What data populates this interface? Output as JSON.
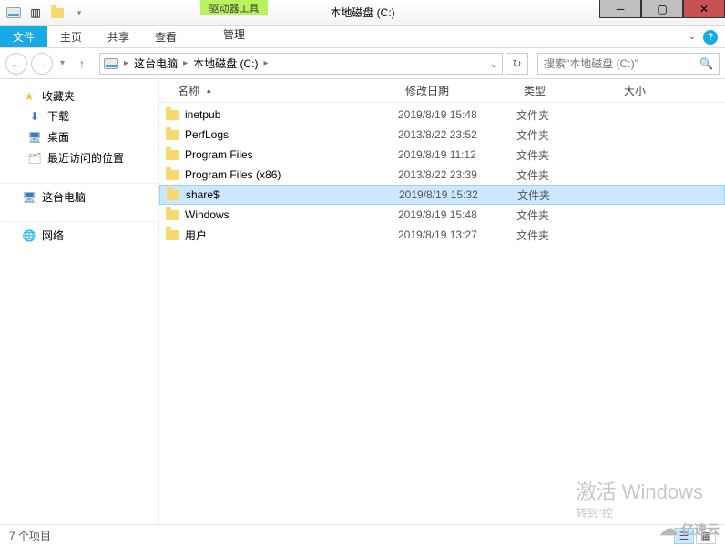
{
  "window": {
    "tool_tab": "驱动器工具",
    "title": "本地磁盘 (C:)"
  },
  "ribbon": {
    "file": "文件",
    "tabs": [
      "主页",
      "共享",
      "查看"
    ],
    "manage": "管理"
  },
  "address": {
    "crumbs": [
      "这台电脑",
      "本地磁盘 (C:)"
    ]
  },
  "search": {
    "placeholder": "搜索\"本地磁盘 (C:)\""
  },
  "sidebar": {
    "favorites": {
      "label": "收藏夹",
      "items": [
        "下载",
        "桌面",
        "最近访问的位置"
      ]
    },
    "this_pc": "这台电脑",
    "network": "网络"
  },
  "columns": {
    "name": "名称",
    "date": "修改日期",
    "type": "类型",
    "size": "大小"
  },
  "files": [
    {
      "name": "inetpub",
      "date": "2019/8/19 15:48",
      "type": "文件夹",
      "selected": false
    },
    {
      "name": "PerfLogs",
      "date": "2013/8/22 23:52",
      "type": "文件夹",
      "selected": false
    },
    {
      "name": "Program Files",
      "date": "2019/8/19 11:12",
      "type": "文件夹",
      "selected": false
    },
    {
      "name": "Program Files (x86)",
      "date": "2013/8/22 23:39",
      "type": "文件夹",
      "selected": false
    },
    {
      "name": "share$",
      "date": "2019/8/19 15:32",
      "type": "文件夹",
      "selected": true
    },
    {
      "name": "Windows",
      "date": "2019/8/19 15:48",
      "type": "文件夹",
      "selected": false
    },
    {
      "name": "用户",
      "date": "2019/8/19 13:27",
      "type": "文件夹",
      "selected": false
    }
  ],
  "status": {
    "count": "7 个项目"
  },
  "watermark": {
    "line1": "激活 Windows",
    "line2": "转到\"控"
  },
  "brand": "亿速云"
}
